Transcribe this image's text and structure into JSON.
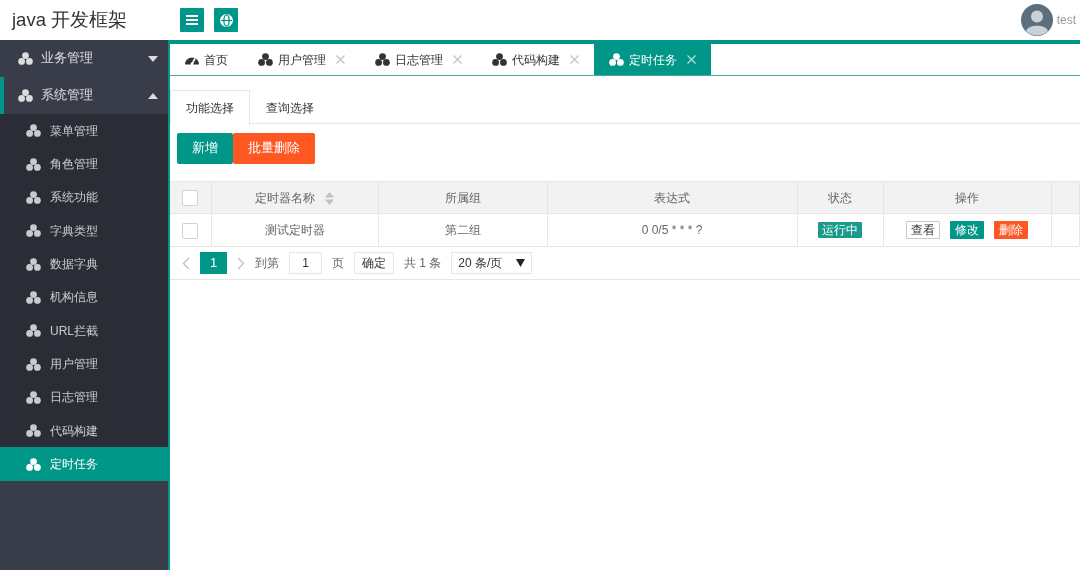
{
  "header": {
    "logo": "java 开发框架",
    "user": "test"
  },
  "sidebar": {
    "items": [
      {
        "label": "业务管理",
        "expanded": false
      },
      {
        "label": "系统管理",
        "expanded": true,
        "children": [
          {
            "label": "菜单管理",
            "selected": false
          },
          {
            "label": "角色管理",
            "selected": false
          },
          {
            "label": "系统功能",
            "selected": false
          },
          {
            "label": "字典类型",
            "selected": false
          },
          {
            "label": "数据字典",
            "selected": false
          },
          {
            "label": "机构信息",
            "selected": false
          },
          {
            "label": "URL拦截",
            "selected": false
          },
          {
            "label": "用户管理",
            "selected": false
          },
          {
            "label": "日志管理",
            "selected": false
          },
          {
            "label": "代码构建",
            "selected": false
          },
          {
            "label": "定时任务",
            "selected": true
          }
        ]
      }
    ]
  },
  "tabs": [
    {
      "kind": "home",
      "label": "首页",
      "selected": false
    },
    {
      "kind": "page",
      "label": "用户管理",
      "selected": false
    },
    {
      "kind": "page",
      "label": "日志管理",
      "selected": false
    },
    {
      "kind": "page",
      "label": "代码构建",
      "selected": false
    },
    {
      "kind": "page",
      "label": "定时任务",
      "selected": true
    }
  ],
  "subtabs": [
    {
      "label": "功能选择",
      "selected": true
    },
    {
      "label": "查询选择",
      "selected": false
    }
  ],
  "toolbar": [
    {
      "label": "新增",
      "kind": "primary"
    },
    {
      "label": "批量删除",
      "kind": "danger"
    }
  ],
  "table": {
    "select_all": {
      "checked": false
    },
    "columns": [
      {
        "label": "定时器名称",
        "sortable": true
      },
      {
        "label": "所属组",
        "sortable": false
      },
      {
        "label": "表达式",
        "sortable": false
      },
      {
        "label": "状态",
        "sortable": false
      },
      {
        "label": "操作",
        "sortable": false
      }
    ],
    "rows": [
      {
        "checked": false,
        "cells": [
          "测试定时器",
          "第二组",
          "0 0/5 * * * ?"
        ],
        "status": "运行中",
        "actions": [
          {
            "label": "查看",
            "kind": "plain"
          },
          {
            "label": "修改",
            "kind": "primary"
          },
          {
            "label": "删除",
            "kind": "danger"
          }
        ]
      }
    ]
  },
  "pagination": {
    "pages": [
      {
        "label": "1",
        "selected": true
      }
    ],
    "goto_label": "到第",
    "page_input": "1",
    "page_unit": "页",
    "confirm": "确定",
    "total": "共 1 条",
    "page_size": "20 条/页"
  }
}
